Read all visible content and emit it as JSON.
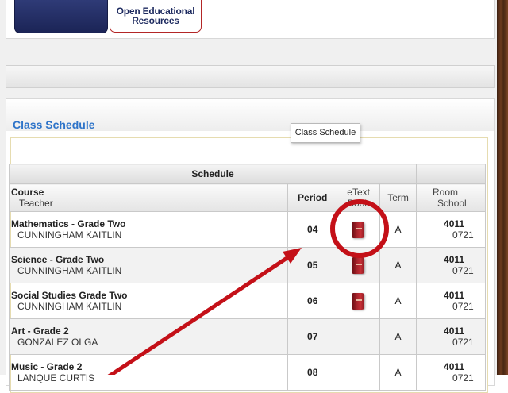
{
  "top_links": {
    "oer_line1": "Open Educational",
    "oer_line2": "Resources"
  },
  "section": {
    "title": "Class Schedule"
  },
  "tooltip": {
    "text": "Class Schedule"
  },
  "schedule": {
    "caption": "Schedule",
    "headers": {
      "course": "Course",
      "teacher": "Teacher",
      "period": "Period",
      "etext_line1": "eText",
      "etext_line2": "Book",
      "term": "Term",
      "room": "Room",
      "school": "School"
    },
    "rows": [
      {
        "course": "Mathematics - Grade Two",
        "teacher": "CUNNINGHAM KAITLIN",
        "period": "04",
        "etext": true,
        "term": "A",
        "room": "4011",
        "school": "0721"
      },
      {
        "course": "Science - Grade Two",
        "teacher": "CUNNINGHAM KAITLIN",
        "period": "05",
        "etext": true,
        "term": "A",
        "room": "4011",
        "school": "0721"
      },
      {
        "course": "Social Studies Grade Two",
        "teacher": "CUNNINGHAM KAITLIN",
        "period": "06",
        "etext": true,
        "term": "A",
        "room": "4011",
        "school": "0721"
      },
      {
        "course": "Art - Grade 2",
        "teacher": "GONZALEZ OLGA",
        "period": "07",
        "etext": false,
        "term": "A",
        "room": "4011",
        "school": "0721"
      },
      {
        "course": "Music - Grade 2",
        "teacher": "LANQUE CURTIS",
        "period": "08",
        "etext": false,
        "term": "A",
        "room": "4011",
        "school": "0721"
      }
    ]
  },
  "annotation_color": "#c41018",
  "icons": {
    "etext": "red-book-icon"
  }
}
